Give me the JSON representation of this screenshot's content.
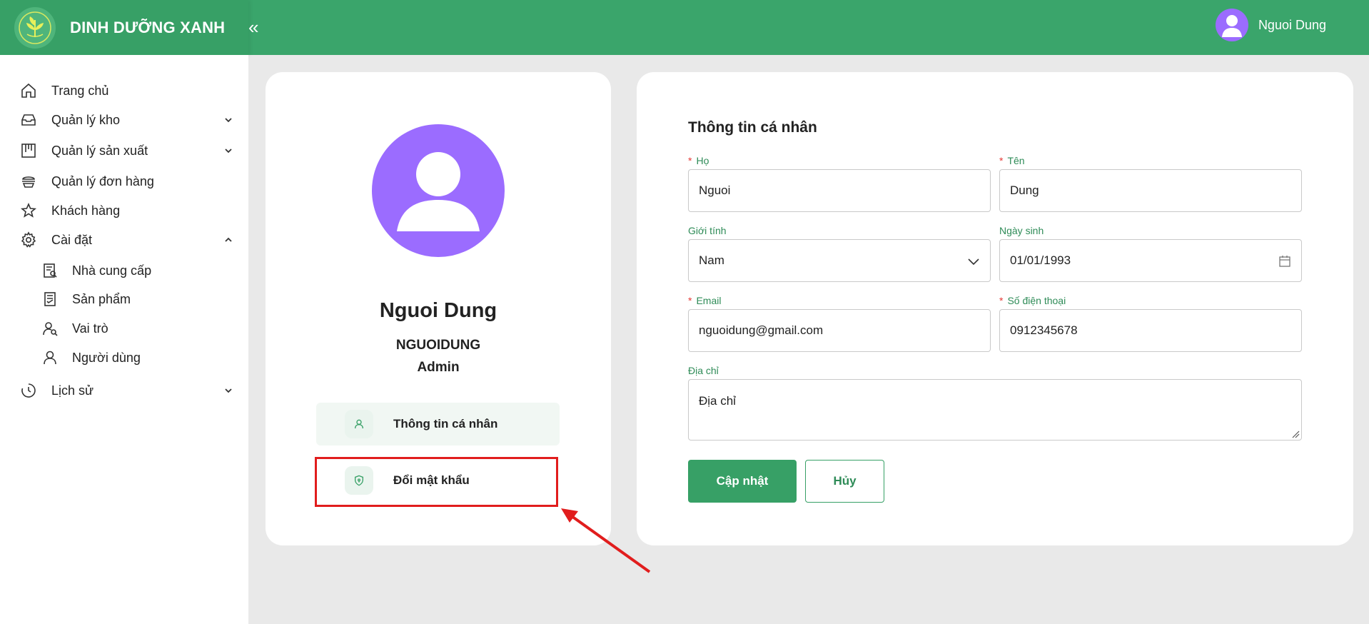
{
  "brand": {
    "name": "DINH DƯỠNG XANH"
  },
  "header": {
    "collapse_glyph": "«",
    "user_name": "Nguoi Dung"
  },
  "sidebar": {
    "items": [
      {
        "label": "Trang chủ",
        "icon": "home-icon"
      },
      {
        "label": "Quản lý kho",
        "icon": "inbox-icon"
      },
      {
        "label": "Quản lý sản xuất",
        "icon": "board-icon"
      },
      {
        "label": "Quản lý đơn hàng",
        "icon": "order-icon"
      },
      {
        "label": "Khách hàng",
        "icon": "star-icon"
      },
      {
        "label": "Cài đặt",
        "icon": "gear-icon"
      },
      {
        "label": "Lịch sử",
        "icon": "history-icon"
      }
    ],
    "sub_items": [
      {
        "label": "Nhà cung cấp",
        "icon": "supplier-icon"
      },
      {
        "label": "Sản phẩm",
        "icon": "product-icon"
      },
      {
        "label": "Vai trò",
        "icon": "role-icon"
      },
      {
        "label": "Người dùng",
        "icon": "user-icon"
      }
    ]
  },
  "profile": {
    "name": "Nguoi Dung",
    "username": "NGUOIDUNG",
    "role": "Admin",
    "menu": [
      {
        "label": "Thông tin cá nhân",
        "icon": "user-icon"
      },
      {
        "label": "Đổi mật khẩu",
        "icon": "shield-key-icon"
      }
    ]
  },
  "form": {
    "title": "Thông tin cá nhân",
    "last_name": {
      "label": "Họ",
      "value": "Nguoi"
    },
    "first_name": {
      "label": "Tên",
      "value": "Dung"
    },
    "gender": {
      "label": "Giới tính",
      "value": "Nam"
    },
    "dob": {
      "label": "Ngày sinh",
      "value": "01/01/1993"
    },
    "email": {
      "label": "Email",
      "value": "nguoidung@gmail.com"
    },
    "phone": {
      "label": "Số điện thoại",
      "value": "0912345678"
    },
    "address": {
      "label": "Địa chỉ",
      "placeholder": "Địa chỉ"
    },
    "required_mark": "*",
    "update_label": "Cập nhật",
    "cancel_label": "Hủy"
  },
  "colors": {
    "primary": "#3aa56b",
    "avatar": "#9b6cff",
    "annotation": "#e11d1d"
  }
}
